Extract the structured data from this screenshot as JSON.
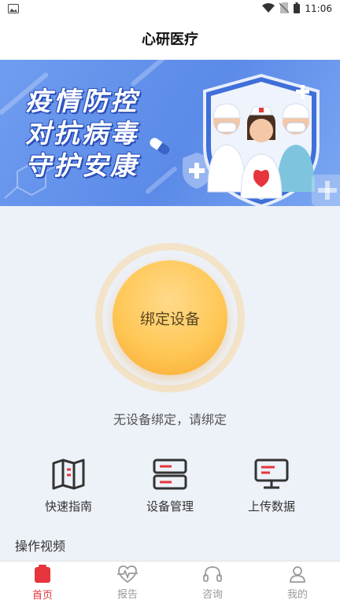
{
  "status_bar": {
    "time": "11:06",
    "icons": [
      "image-icon",
      "wifi-icon",
      "no-sim-icon",
      "battery-icon"
    ]
  },
  "app": {
    "title": "心研医疗"
  },
  "banner": {
    "lines": [
      "疫情防控",
      "对抗病毒",
      "守护安康"
    ]
  },
  "bind": {
    "button_label": "绑定设备",
    "hint": "无设备绑定，请绑定"
  },
  "quick_actions": [
    {
      "label": "快速指南",
      "icon": "map-guide-icon"
    },
    {
      "label": "设备管理",
      "icon": "server-icon"
    },
    {
      "label": "上传数据",
      "icon": "monitor-upload-icon"
    }
  ],
  "section": {
    "title": "操作视频"
  },
  "tabs": [
    {
      "label": "首页",
      "icon": "home-icon",
      "active": true
    },
    {
      "label": "报告",
      "icon": "heart-report-icon",
      "active": false
    },
    {
      "label": "咨询",
      "icon": "headset-icon",
      "active": false
    },
    {
      "label": "我的",
      "icon": "user-icon",
      "active": false
    }
  ],
  "colors": {
    "accent": "#e6353c",
    "banner_blue": "#5b8ae8",
    "button_orange": "#ffc857",
    "background": "#edf1f8"
  }
}
